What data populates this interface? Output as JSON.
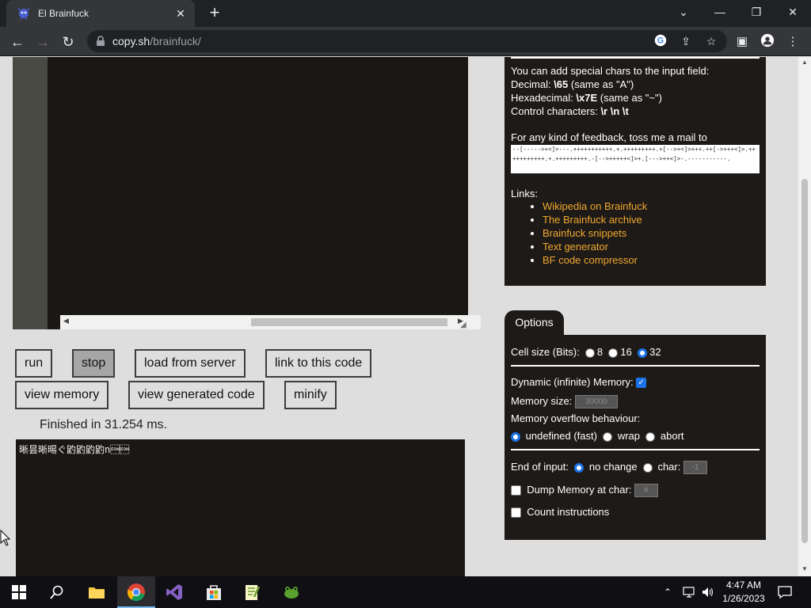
{
  "browser": {
    "tab_title": "El Brainfuck",
    "url_host": "copy.sh",
    "url_path": "/brainfuck/"
  },
  "buttons": {
    "run": "run",
    "stop": "stop",
    "load_from_server": "load from server",
    "link_to_code": "link to this code",
    "view_memory": "view memory",
    "view_generated_code": "view generated code",
    "minify": "minify"
  },
  "status": "Finished in 31.254 ms.",
  "output_text": "晰昙晰晹ぐ䶂䶂䶂䶂n\u0001\u0001",
  "info": {
    "line1": "You can add special chars to the input field:",
    "decimal_label": "Decimal: ",
    "decimal_code": "\\65",
    "decimal_note": " (same as \"A\")",
    "hex_label": "Hexadecimal: ",
    "hex_code": "\\x7E",
    "hex_note": " (same as \"~\")",
    "control_label": "Control characters: ",
    "control_code": "\\r \\n \\t",
    "feedback": "For any kind of feedback, toss me a mail to",
    "bf_code": "--[----->+<]>---.+++++++++++.+.+++++++++.+[-->+<]>+++.++[->+++<]>.+++++++++++.+.+++++++++.-[-->+++++<]>+.[--->++<]>-.-----------.",
    "links_label": "Links:",
    "links": [
      "Wikipedia on Brainfuck",
      "The Brainfuck archive",
      "Brainfuck snippets",
      "Text generator",
      "BF code compressor"
    ]
  },
  "options": {
    "tab_label": "Options",
    "cell_size_label": "Cell size (Bits):",
    "cell_sizes": [
      "8",
      "16",
      "32"
    ],
    "cell_size_selected": "32",
    "dynamic_memory_label": "Dynamic (infinite) Memory:",
    "dynamic_memory_checked": true,
    "memory_size_label": "Memory size:",
    "memory_size_value": "30000",
    "overflow_label": "Memory overflow behaviour:",
    "overflow_options": [
      "undefined (fast)",
      "wrap",
      "abort"
    ],
    "overflow_selected": "undefined (fast)",
    "end_of_input_label": "End of input:",
    "eoi_no_change": "no change",
    "eoi_char": "char:",
    "eoi_char_value": "-1",
    "dump_memory_label": "Dump Memory at char:",
    "dump_memory_value": "#",
    "count_instructions_label": "Count instructions"
  },
  "taskbar": {
    "time": "4:47 AM",
    "date": "1/26/2023"
  },
  "colors": {
    "accent_link": "#f0a830",
    "panel_bg": "#1e1a18",
    "radio_blue": "#1a73e8"
  }
}
